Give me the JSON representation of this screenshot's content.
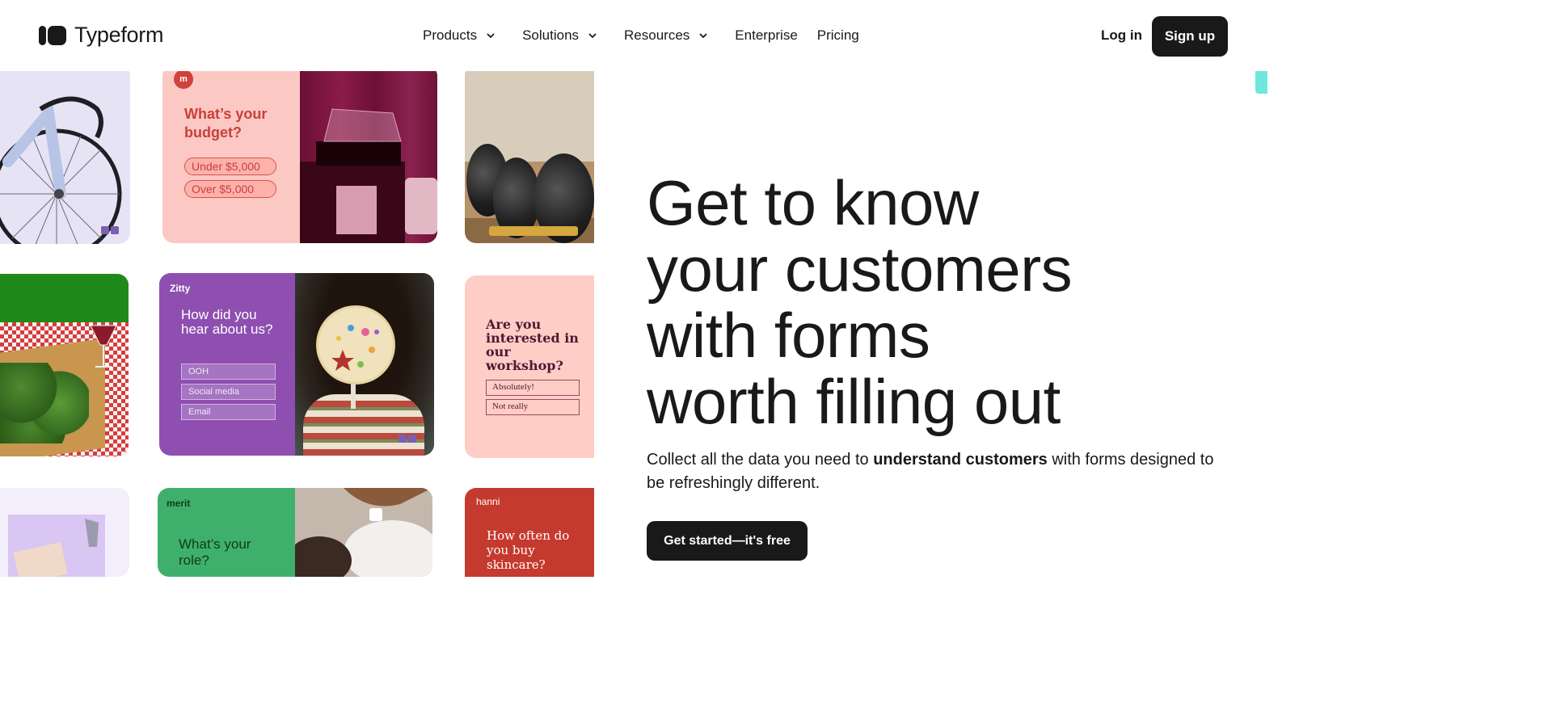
{
  "brand": {
    "name": "Typeform"
  },
  "nav": {
    "items": [
      {
        "label": "Products",
        "dropdown": true
      },
      {
        "label": "Solutions",
        "dropdown": true
      },
      {
        "label": "Resources",
        "dropdown": true
      },
      {
        "label": "Enterprise",
        "dropdown": false
      },
      {
        "label": "Pricing",
        "dropdown": false
      }
    ],
    "login": "Log in",
    "signup": "Sign up"
  },
  "cards": {
    "budget": {
      "question": "What’s your budget?",
      "options": [
        "Under $5,000",
        "Over $5,000"
      ]
    },
    "zitty": {
      "brand": "Zitty",
      "question": "How did you hear about us?",
      "options": [
        "OOH",
        "Social media",
        "Email"
      ]
    },
    "workshop": {
      "question": "Are you interested in our workshop?",
      "options": [
        "Absolutely!",
        "Not really"
      ]
    },
    "merit": {
      "brand": "merit",
      "question": "What’s your role?"
    },
    "hanni": {
      "brand": "hanni",
      "question": "How often do you buy skincare?"
    }
  },
  "hero": {
    "title_lines": [
      "Get to know",
      "your customers",
      "with forms",
      "worth filling out"
    ],
    "subtitle_before": "Collect all the data you need to ",
    "subtitle_bold": "understand customers",
    "subtitle_after": " with forms designed to be refreshingly different.",
    "cta": "Get started—it's free"
  },
  "colors": {
    "ink": "#191919",
    "accent_edge": "#6ee7df",
    "budget_pink": "#fbc8c4",
    "zitty_purple": "#8e4fb0",
    "workshop_pink": "#fecdc6",
    "merit_green": "#3fb06b",
    "hanni_red": "#c53a2e"
  }
}
